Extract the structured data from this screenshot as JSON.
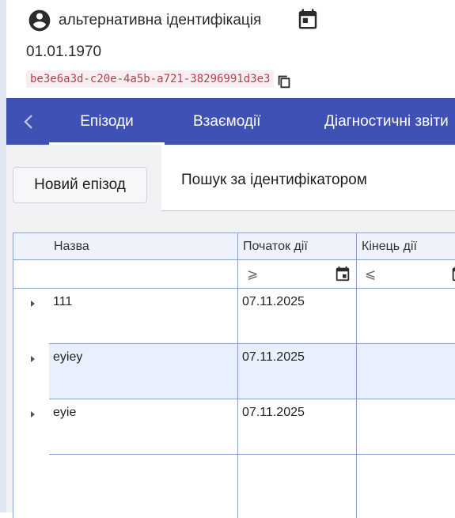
{
  "patient": {
    "name": "альтернативна ідентифікація",
    "birth_date": "01.01.1970",
    "uuid": "be3e6a3d-c20e-4a5b-a721-38296991d3e3"
  },
  "tabs": [
    {
      "label": "Епізоди",
      "active": true
    },
    {
      "label": "Взаємодії",
      "active": false
    },
    {
      "label": "Діагностичні звіти",
      "active": false
    }
  ],
  "toolbar": {
    "new_episode_label": "Новий епізод",
    "search_by_id_label": "Пошук за ідентифікатором"
  },
  "table": {
    "columns": [
      "Назва",
      "Початок дії",
      "Кінець дії"
    ],
    "filters": {
      "start_op": "⩾",
      "end_op": "⩽"
    },
    "rows": [
      {
        "name": "111",
        "start": "07.11.2025",
        "end": "",
        "selected": false
      },
      {
        "name": "eyiey",
        "start": "07.11.2025",
        "end": "",
        "selected": true
      },
      {
        "name": "eyie",
        "start": "07.11.2025",
        "end": "",
        "selected": false
      }
    ]
  },
  "colors": {
    "primary": "#3f51b5",
    "selected_row": "#e8f0fe",
    "uuid_text": "#b3424a"
  }
}
